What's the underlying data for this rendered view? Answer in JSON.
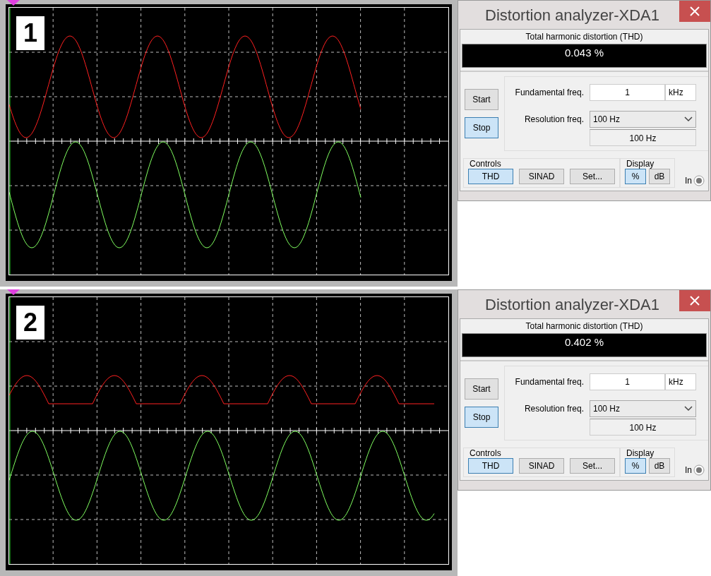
{
  "panels": [
    {
      "label": "1",
      "kind": "full",
      "analyzer": {
        "title": "Distortion analyzer-XDA1",
        "heading": "Total harmonic distortion (THD)",
        "reading": "0.043 %",
        "run_buttons": [
          {
            "label": "Start",
            "selected": false
          },
          {
            "label": "Stop",
            "selected": true
          }
        ],
        "fundamental": {
          "label": "Fundamental freq.",
          "value": "1",
          "unit": "kHz"
        },
        "resolution": {
          "label": "Resolution freq.",
          "value": "100 Hz",
          "readout": "100 Hz"
        },
        "controls": {
          "label": "Controls",
          "buttons": [
            {
              "label": "THD",
              "selected": true
            },
            {
              "label": "SINAD",
              "selected": false
            },
            {
              "label": "Set...",
              "selected": false
            }
          ]
        },
        "display": {
          "label": "Display",
          "buttons": [
            {
              "label": "%",
              "selected": true
            },
            {
              "label": "dB",
              "selected": false
            }
          ]
        },
        "input_label": "In"
      }
    },
    {
      "label": "2",
      "kind": "clipped",
      "analyzer": {
        "title": "Distortion analyzer-XDA1",
        "heading": "Total harmonic distortion (THD)",
        "reading": "0.402 %",
        "run_buttons": [
          {
            "label": "Start",
            "selected": false
          },
          {
            "label": "Stop",
            "selected": true
          }
        ],
        "fundamental": {
          "label": "Fundamental freq.",
          "value": "1",
          "unit": "kHz"
        },
        "resolution": {
          "label": "Resolution freq.",
          "value": "100 Hz",
          "readout": "100 Hz"
        },
        "controls": {
          "label": "Controls",
          "buttons": [
            {
              "label": "THD",
              "selected": true
            },
            {
              "label": "SINAD",
              "selected": false
            },
            {
              "label": "Set...",
              "selected": false
            }
          ]
        },
        "display": {
          "label": "Display",
          "buttons": [
            {
              "label": "%",
              "selected": true
            },
            {
              "label": "dB",
              "selected": false
            }
          ]
        },
        "input_label": "In"
      }
    }
  ]
}
